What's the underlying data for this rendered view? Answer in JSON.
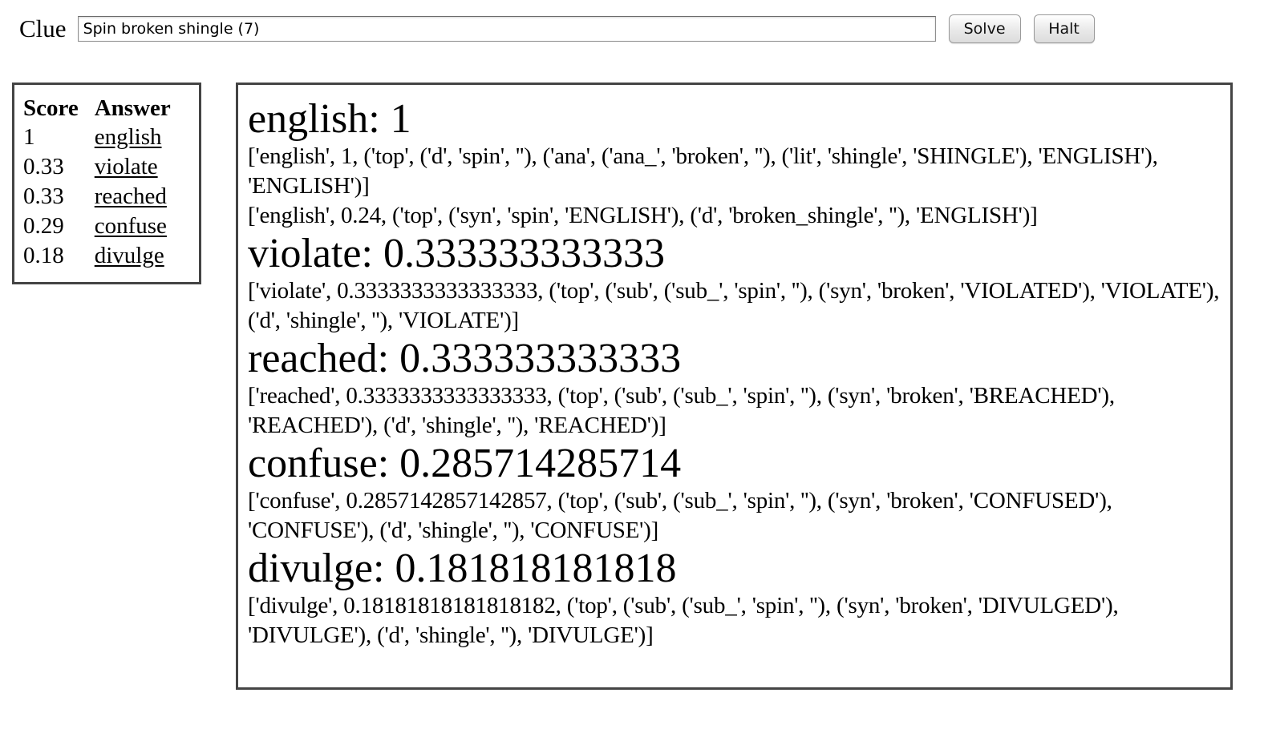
{
  "form": {
    "clue_label": "Clue",
    "clue_value": "Spin broken shingle (7)",
    "solve_label": "Solve",
    "halt_label": "Halt"
  },
  "score_table": {
    "headers": [
      "Score",
      "Answer"
    ],
    "rows": [
      {
        "score": "1",
        "answer": "english"
      },
      {
        "score": "0.33",
        "answer": "violate"
      },
      {
        "score": "0.33",
        "answer": "reached"
      },
      {
        "score": "0.29",
        "answer": "confuse"
      },
      {
        "score": "0.18",
        "answer": "divulge"
      }
    ]
  },
  "results": [
    {
      "answer": "english",
      "score": "1",
      "details": [
        "['english', 1, ('top', ('d', 'spin', ''), ('ana', ('ana_', 'broken', ''), ('lit', 'shingle', 'SHINGLE'), 'ENGLISH'), 'ENGLISH')]",
        "['english', 0.24, ('top', ('syn', 'spin', 'ENGLISH'), ('d', 'broken_shingle', ''), 'ENGLISH')]"
      ]
    },
    {
      "answer": "violate",
      "score": "0.333333333333",
      "details": [
        "['violate', 0.3333333333333333, ('top', ('sub', ('sub_', 'spin', ''), ('syn', 'broken', 'VIOLATED'), 'VIOLATE'), ('d', 'shingle', ''), 'VIOLATE')]"
      ]
    },
    {
      "answer": "reached",
      "score": "0.333333333333",
      "details": [
        "['reached', 0.3333333333333333, ('top', ('sub', ('sub_', 'spin', ''), ('syn', 'broken', 'BREACHED'), 'REACHED'), ('d', 'shingle', ''), 'REACHED')]"
      ]
    },
    {
      "answer": "confuse",
      "score": "0.285714285714",
      "details": [
        "['confuse', 0.2857142857142857, ('top', ('sub', ('sub_', 'spin', ''), ('syn', 'broken', 'CONFUSED'), 'CONFUSE'), ('d', 'shingle', ''), 'CONFUSE')]"
      ]
    },
    {
      "answer": "divulge",
      "score": "0.181818181818",
      "details": [
        "['divulge', 0.18181818181818182, ('top', ('sub', ('sub_', 'spin', ''), ('syn', 'broken', 'DIVULGED'), 'DIVULGE'), ('d', 'shingle', ''), 'DIVULGE')]"
      ]
    }
  ]
}
